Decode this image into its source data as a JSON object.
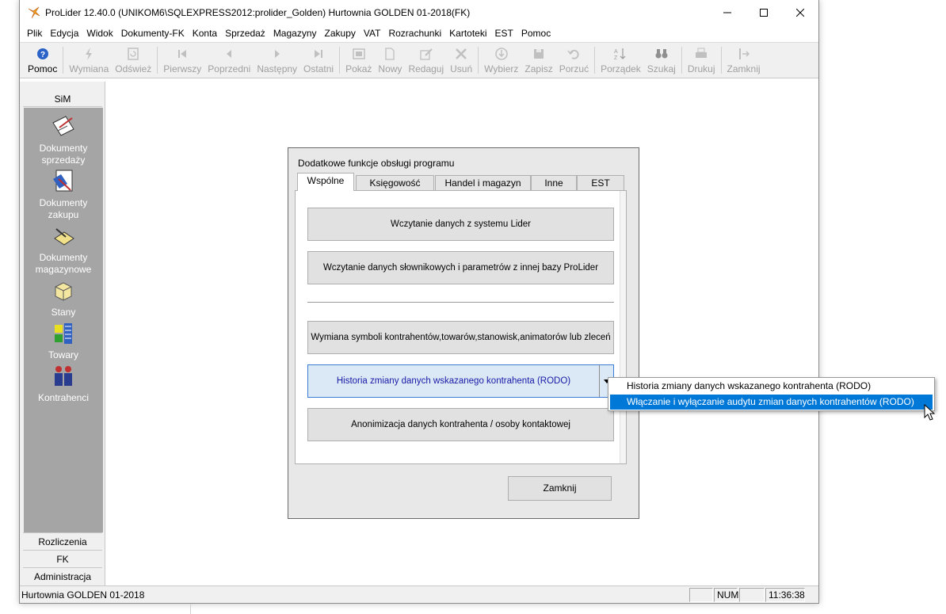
{
  "window": {
    "title": "ProLider 12.40.0  (UNIKOM6\\SQLEXPRESS2012:prolider_Golden) Hurtownia GOLDEN 01-2018(FK)"
  },
  "menu": [
    "Plik",
    "Edycja",
    "Widok",
    "Dokumenty-FK",
    "Konta",
    "Sprzedaż",
    "Magazyny",
    "Zakupy",
    "VAT",
    "Rozrachunki",
    "Kartoteki",
    "EST",
    "Pomoc"
  ],
  "toolbar": {
    "pomoc": "Pomoc",
    "wymiana": "Wymiana",
    "odswiez": "Odśwież",
    "pierwszy": "Pierwszy",
    "poprzedni": "Poprzedni",
    "nastepny": "Następny",
    "ostatni": "Ostatni",
    "pokaz": "Pokaż",
    "nowy": "Nowy",
    "redaguj": "Redaguj",
    "usun": "Usuń",
    "wybierz": "Wybierz",
    "zapisz": "Zapisz",
    "porzuc": "Porzuć",
    "porzadek": "Porządek",
    "szukaj": "Szukaj",
    "drukuj": "Drukuj",
    "zamknij": "Zamknij"
  },
  "sidebar": {
    "header": "SiM",
    "items": [
      {
        "line1": "Dokumenty",
        "line2": "sprzedaży"
      },
      {
        "line1": "Dokumenty",
        "line2": "zakupu"
      },
      {
        "line1": "Dokumenty",
        "line2": "magazynowe"
      },
      {
        "line1": "Stany",
        "line2": ""
      },
      {
        "line1": "Towary",
        "line2": ""
      },
      {
        "line1": "Kontrahenci",
        "line2": ""
      }
    ],
    "bottom": [
      "Rozliczenia",
      "FK",
      "Administracja"
    ]
  },
  "statusbar": {
    "left": "Hurtownia GOLDEN 01-2018",
    "num": "NUM",
    "time": "11:36:38"
  },
  "dialog": {
    "title": "Dodatkowe funkcje obsługi programu",
    "tabs": [
      "Wspólne",
      "Księgowość",
      "Handel i magazyn",
      "Inne",
      "EST"
    ],
    "buttons": {
      "b1": "Wczytanie danych z systemu Lider",
      "b2": "Wczytanie danych słownikowych i parametrów z innej bazy ProLider",
      "b3": "Wymiana symboli kontrahentów,towarów,stanowisk,animatorów lub zleceń",
      "b4": "Historia zmiany danych wskazanego kontrahenta (RODO)",
      "b5": "Anonimizacja danych kontrahenta / osoby kontaktowej"
    },
    "close": "Zamknij"
  },
  "popup": {
    "items": [
      "Historia zmiany danych wskazanego kontrahenta (RODO)",
      "Włączanie i wyłączanie audytu zmian danych kontrahentów (RODO)"
    ],
    "selected_index": 1
  },
  "colors": {
    "selection": "#0078d7",
    "sidebar_panel": "#a5a5a5",
    "dialog_bg": "#e8e8e8"
  }
}
